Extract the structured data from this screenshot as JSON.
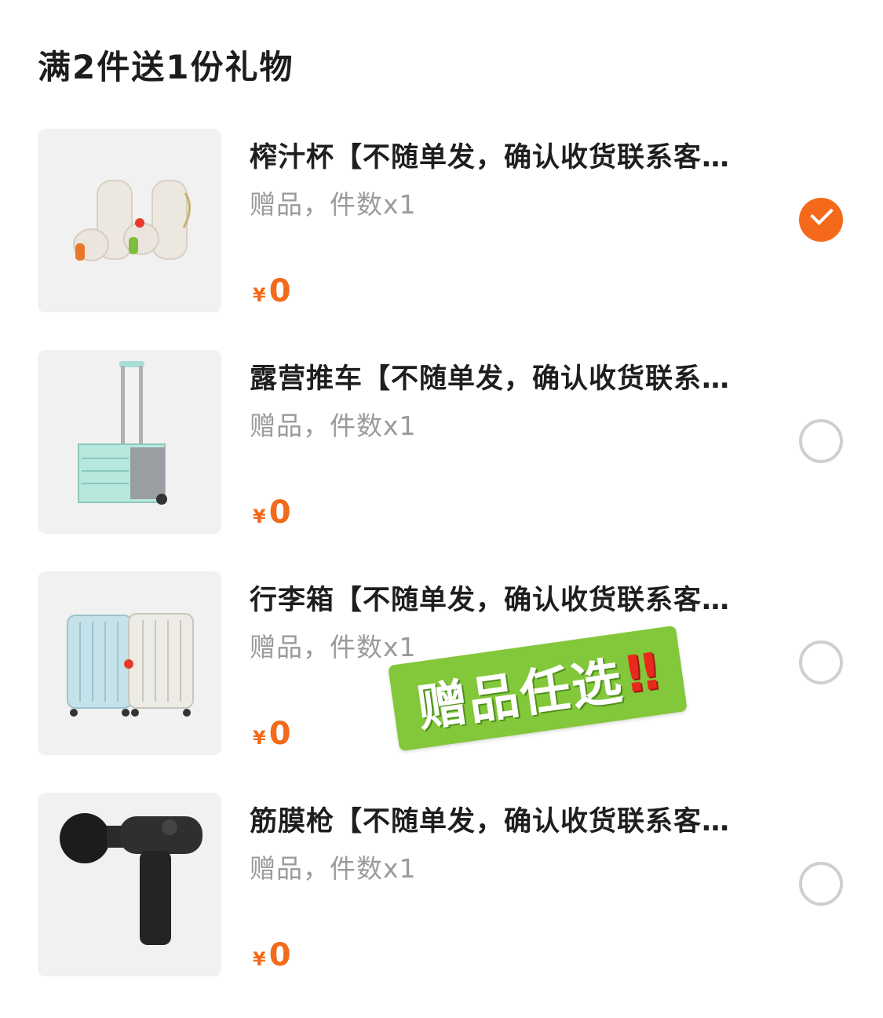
{
  "header": {
    "title": "满2件送1份礼物"
  },
  "items": [
    {
      "title": "榨汁杯【不随单发，确认收货联系客…",
      "subtitle": "赠品，件数x1",
      "currency": "¥",
      "price": "0",
      "selected": true,
      "image_icon": "juicer-cup-icon"
    },
    {
      "title": "露营推车【不随单发，确认收货联系…",
      "subtitle": "赠品，件数x1",
      "currency": "¥",
      "price": "0",
      "selected": false,
      "image_icon": "camping-cart-icon"
    },
    {
      "title": "行李箱【不随单发，确认收货联系客…",
      "subtitle": "赠品，件数x1",
      "currency": "¥",
      "price": "0",
      "selected": false,
      "image_icon": "luggage-icon"
    },
    {
      "title": "筋膜枪【不随单发，确认收货联系客…",
      "subtitle": "赠品，件数x1",
      "currency": "¥",
      "price": "0",
      "selected": false,
      "image_icon": "massage-gun-icon"
    }
  ],
  "sticker": {
    "text": "赠品任选",
    "mark": "‼"
  },
  "colors": {
    "accent": "#f46a1a",
    "price": "#f26a1b",
    "sticker_bg": "#82c83a",
    "subtitle": "#9a9a9a"
  }
}
